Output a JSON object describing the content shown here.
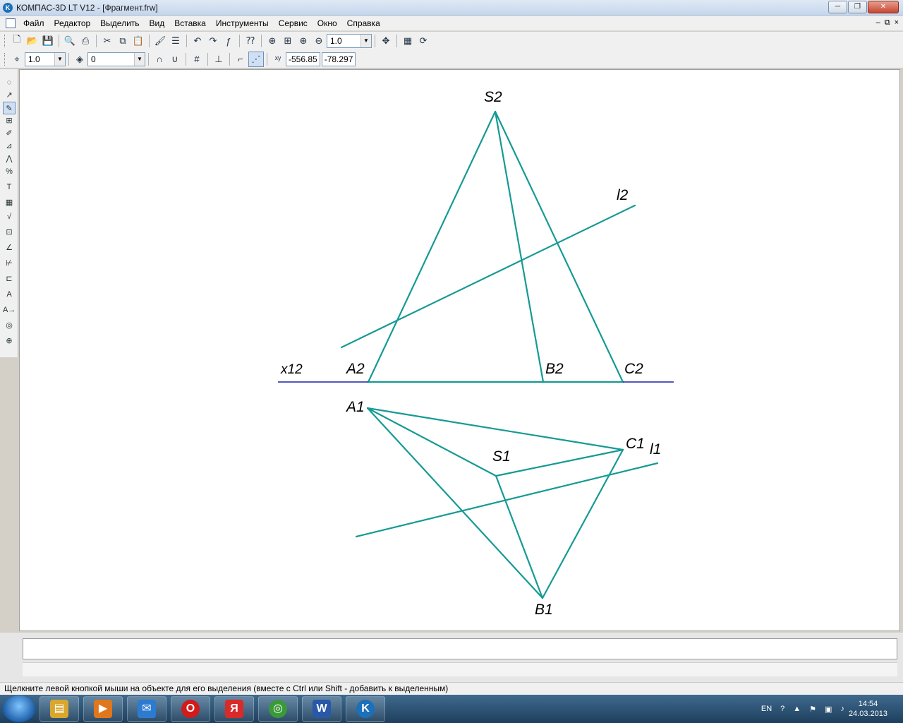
{
  "window": {
    "title": "КОМПАС-3D LT V12 - [Фрагмент.frw]",
    "app_icon": "kompas-logo-icon",
    "buttons": {
      "minimize": "─",
      "maximize": "❐",
      "close": "✕"
    }
  },
  "menu": {
    "items": [
      "Файл",
      "Редактор",
      "Выделить",
      "Вид",
      "Вставка",
      "Инструменты",
      "Сервис",
      "Окно",
      "Справка"
    ],
    "mdi_buttons": {
      "minimize": "‒",
      "restore": "⧉",
      "close": "×"
    }
  },
  "toolbar1": {
    "zoom_value": "1.0"
  },
  "toolbar2": {
    "step_value": "1.0",
    "layer_value": "0",
    "coord_x": "-556.85",
    "coord_y": "-78.297"
  },
  "drawing": {
    "labels": {
      "s2": "S2",
      "l2": "l2",
      "x12": "x12",
      "a2": "A2",
      "b2": "B2",
      "c2": "C2",
      "a1": "A1",
      "c1": "C1",
      "l1": "l1",
      "s1": "S1",
      "b1": "B1"
    },
    "colors": {
      "edge": "#159a94",
      "axis": "#1a22a8"
    }
  },
  "status": {
    "hint": "Щелкните левой кнопкой мыши на объекте для его выделения (вместе с Ctrl или Shift - добавить к выделенным)"
  },
  "taskbar": {
    "tasks": [
      {
        "name": "explorer-icon",
        "glyph": "▤",
        "color": "#d9a62e"
      },
      {
        "name": "media-player-icon",
        "glyph": "▶",
        "color": "#e0771d"
      },
      {
        "name": "mail-icon",
        "glyph": "✉",
        "color": "#2d7bd1"
      },
      {
        "name": "opera-icon",
        "glyph": "O",
        "color": "#d21b1b"
      },
      {
        "name": "yandex-icon",
        "glyph": "Я",
        "color": "#d92a2a"
      },
      {
        "name": "chrome-icon",
        "glyph": "◎",
        "color": "#3a9a3a"
      },
      {
        "name": "word-icon",
        "glyph": "W",
        "color": "#2a58a8"
      },
      {
        "name": "kompas-icon",
        "glyph": "K",
        "color": "#1c6fb8"
      }
    ],
    "lang": "EN",
    "time": "14:54",
    "date": "24.03.2013"
  }
}
